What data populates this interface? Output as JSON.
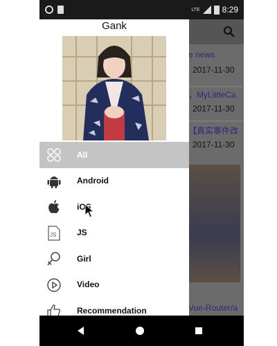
{
  "status_bar": {
    "network": "LTE",
    "time": "8:29"
  },
  "background_app": {
    "rows": [
      {
        "title": "e news.",
        "date": "2017-11-30"
      },
      {
        "title": "，MyLittleCa",
        "date": "2017-11-30"
      },
      {
        "title": "【真实事件改",
        "date": "2017-11-30"
      }
    ],
    "bottom_title": "Vue-Router/a"
  },
  "drawer": {
    "title": "Gank",
    "menu": [
      {
        "label": "All",
        "icon": "grid-icon",
        "active": true
      },
      {
        "label": "Android",
        "icon": "android-icon",
        "active": false
      },
      {
        "label": "iOS",
        "icon": "apple-icon",
        "active": false
      },
      {
        "label": "JS",
        "icon": "js-file-icon",
        "active": false
      },
      {
        "label": "Girl",
        "icon": "female-icon",
        "active": false
      },
      {
        "label": "Video",
        "icon": "play-circle-icon",
        "active": false
      },
      {
        "label": "Recommendation",
        "icon": "thumbs-up-icon",
        "active": false
      }
    ]
  },
  "nav_bar": {
    "buttons": [
      "back-icon",
      "home-icon",
      "recents-icon"
    ]
  }
}
